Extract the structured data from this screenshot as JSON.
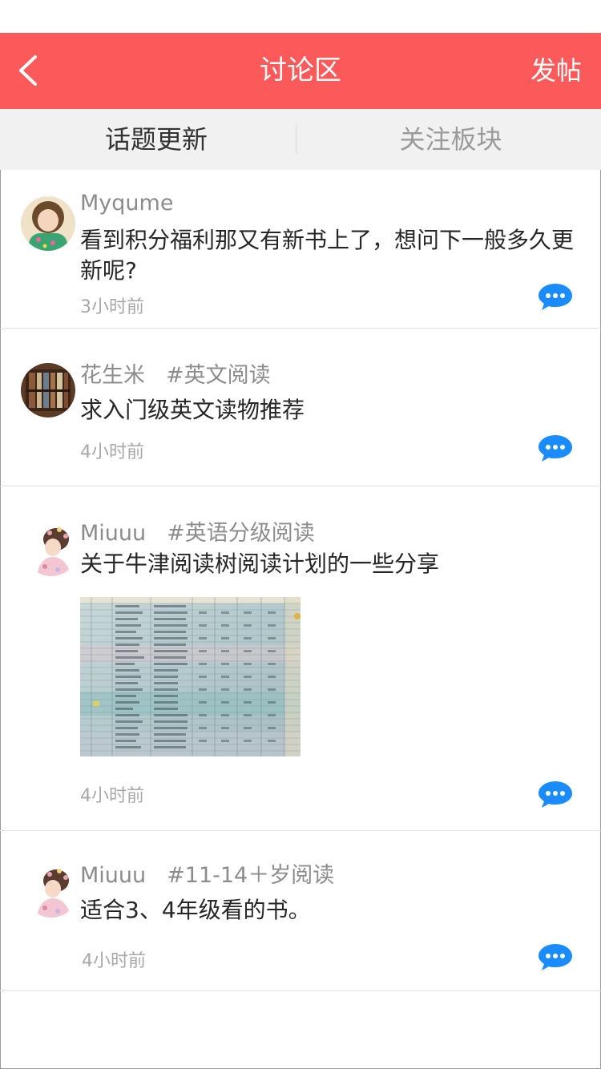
{
  "nav": {
    "title": "讨论区",
    "post_label": "发帖"
  },
  "tabs": [
    {
      "label": "话题更新",
      "active": true
    },
    {
      "label": "关注板块",
      "active": false
    }
  ],
  "posts": [
    {
      "user": "Myqume",
      "tag": "",
      "content": "看到积分福利那又有新书上了，想问下一般多久更新呢?",
      "time": "3小时前"
    },
    {
      "user": "花生米",
      "tag": "#英文阅读",
      "content": "求入门级英文读物推荐",
      "time": "4小时前"
    },
    {
      "user": "Miuuu",
      "tag": "#英语分级阅读",
      "content": "关于牛津阅读树阅读计划的一些分享",
      "time": "4小时前",
      "image": "spreadsheet-photo"
    },
    {
      "user": "Miuuu",
      "tag": "#11-14＋岁阅读",
      "content": "适合3、4年级看的书。",
      "time": "4小时前"
    }
  ],
  "colors": {
    "nav_bg": "#fc5a5a",
    "tab_bg": "#f1f1f1",
    "comment_icon": "#1a8cff"
  }
}
